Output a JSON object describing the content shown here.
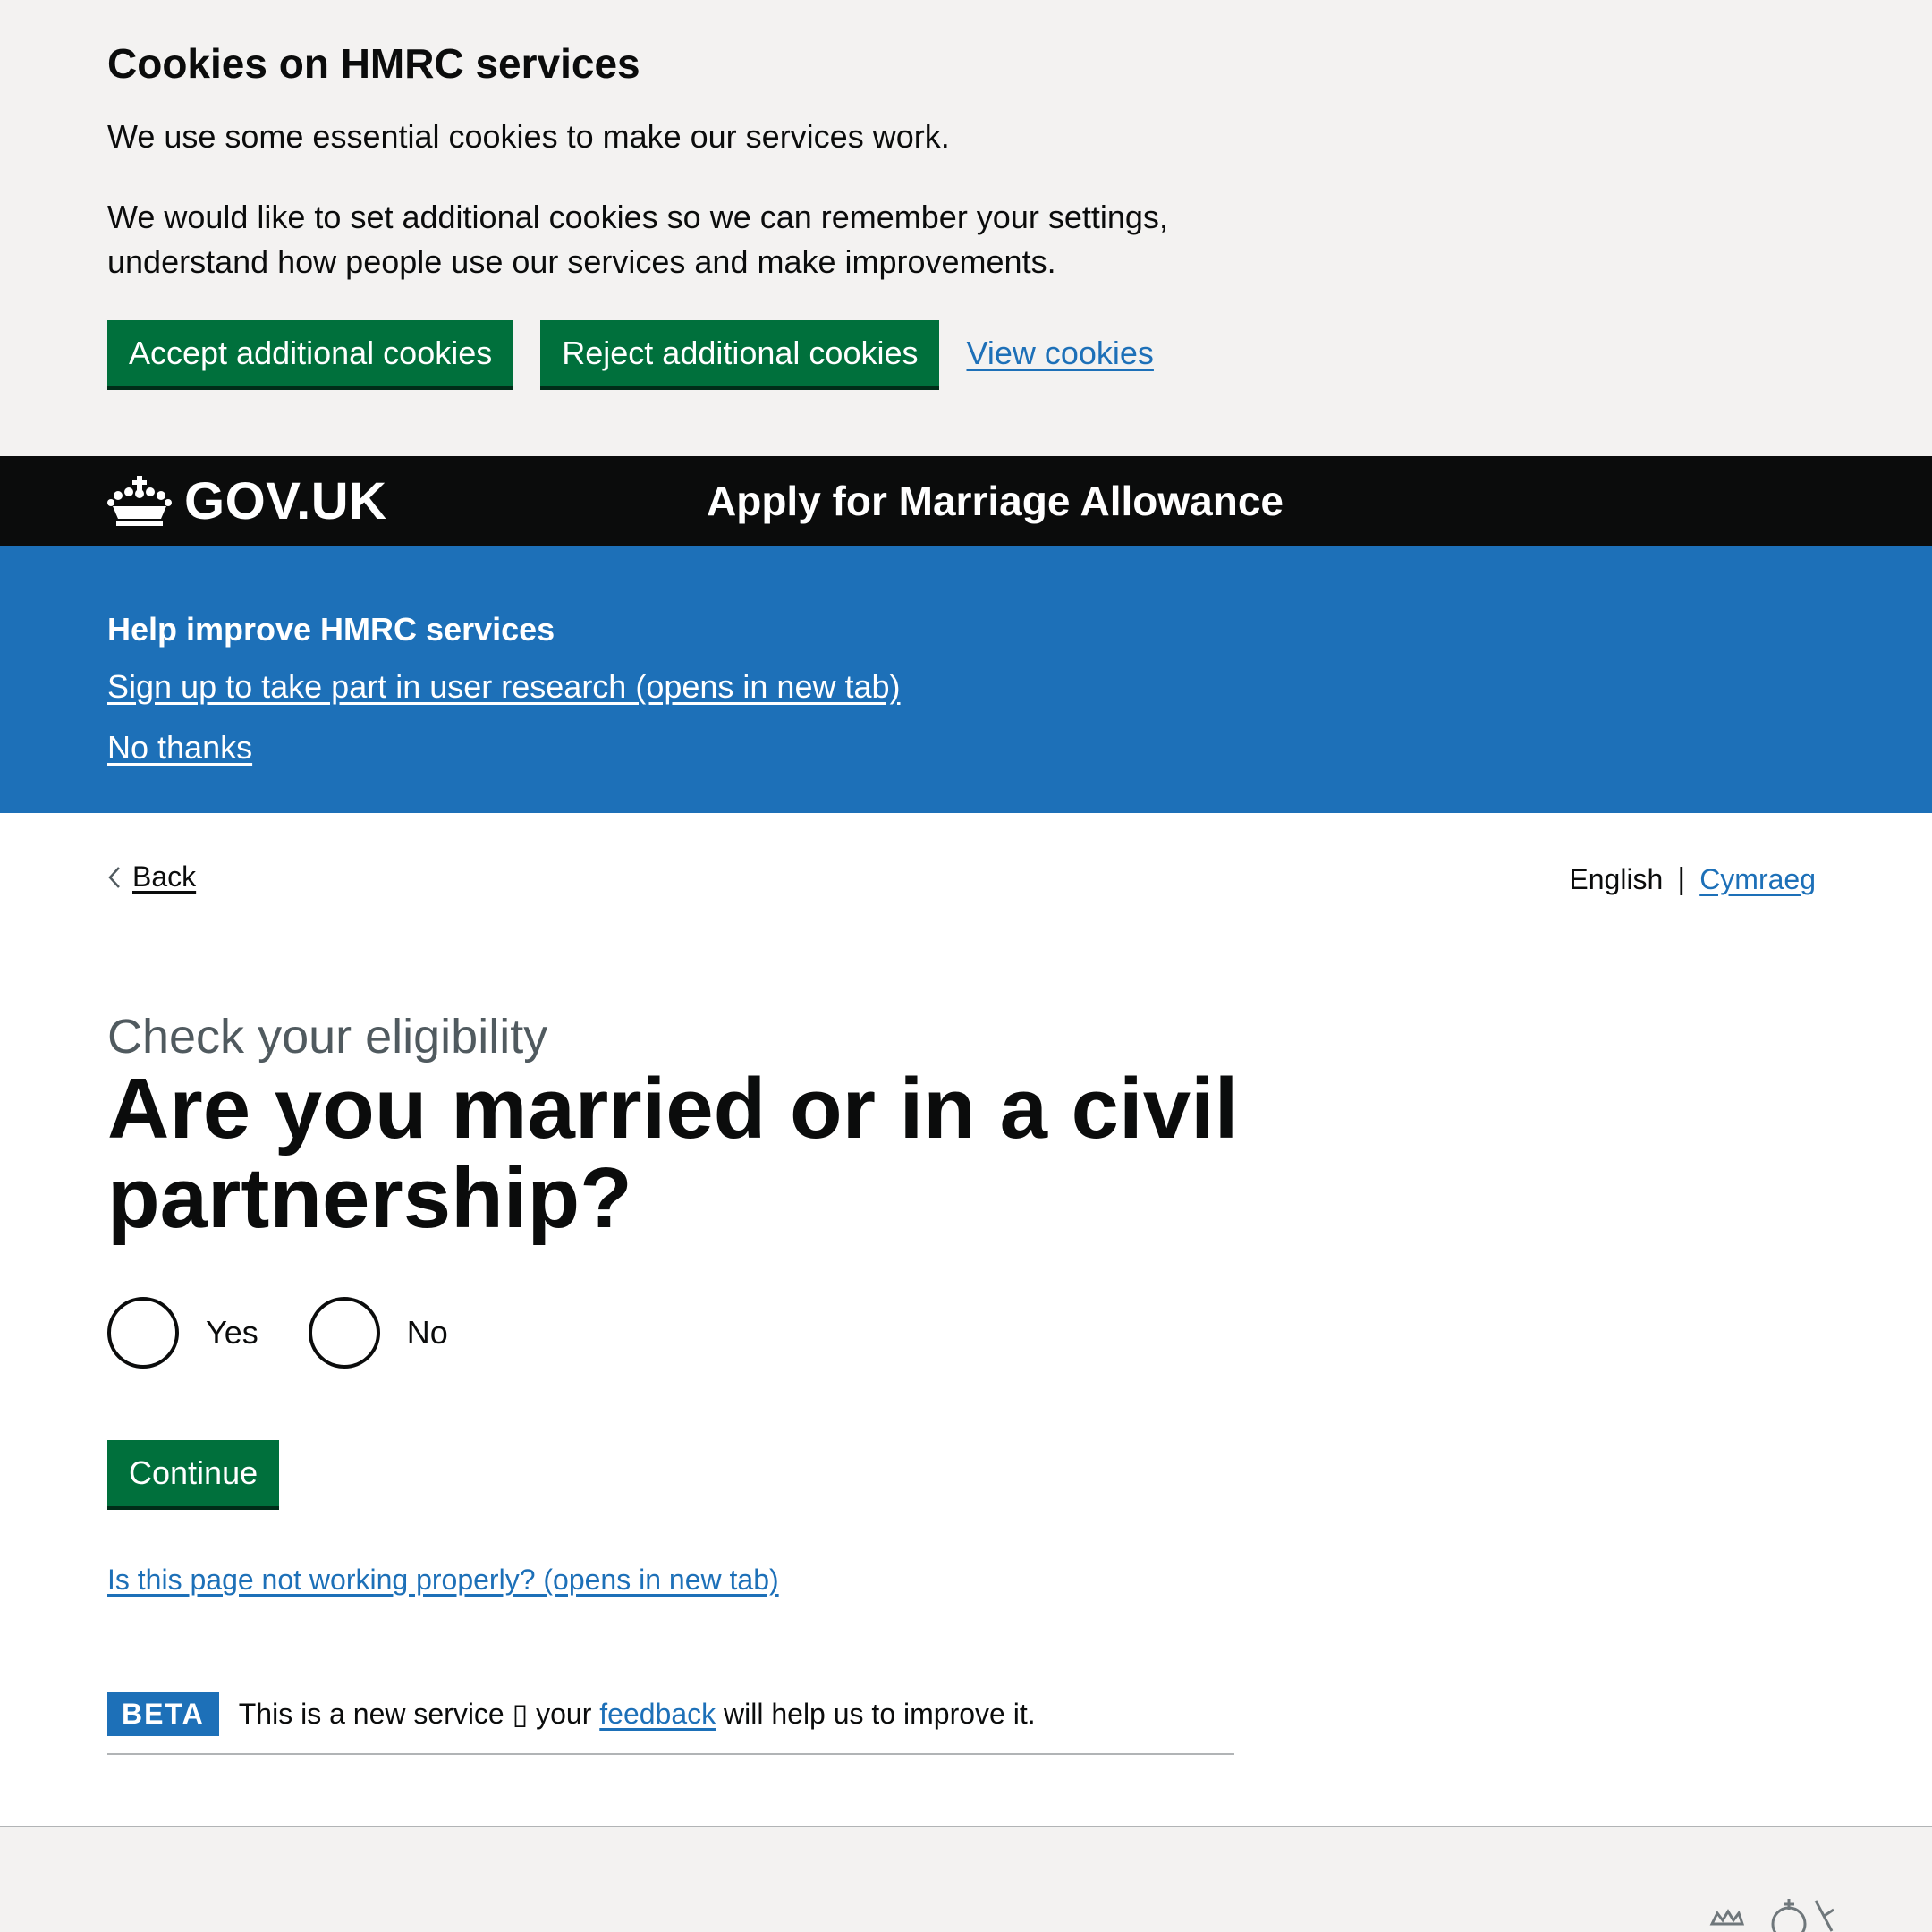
{
  "cookie_banner": {
    "title": "Cookies on HMRC services",
    "text1": "We use some essential cookies to make our services work.",
    "text2": "We would like to set additional cookies so we can remember your settings, understand how people use our services and make improvements.",
    "accept_label": "Accept additional cookies",
    "reject_label": "Reject additional cookies",
    "view_label": "View cookies"
  },
  "header": {
    "logo_text": "GOV.UK",
    "service_name": "Apply for Marriage Allowance"
  },
  "research_banner": {
    "title": "Help improve HMRC services",
    "signup_label": "Sign up to take part in user research (opens in new tab)",
    "no_thanks_label": "No thanks"
  },
  "nav": {
    "back_label": "Back",
    "lang_current": "English",
    "lang_separator": "|",
    "lang_other": "Cymraeg"
  },
  "form": {
    "caption": "Check your eligibility",
    "question": "Are you married or in a civil partnership?",
    "options": [
      {
        "label": "Yes",
        "selected": false
      },
      {
        "label": "No",
        "selected": false
      }
    ],
    "continue_label": "Continue"
  },
  "report_link": "Is this page not working properly? (opens in new tab)",
  "beta": {
    "tag": "BETA",
    "text_before": "This is a new service ▯ your",
    "feedback_label": "feedback",
    "text_after": "will help us to improve it."
  },
  "colors": {
    "button_green": "#00703c",
    "link_blue": "#1d70b8",
    "header_black": "#0b0c0c",
    "banner_grey": "#f3f2f1"
  }
}
